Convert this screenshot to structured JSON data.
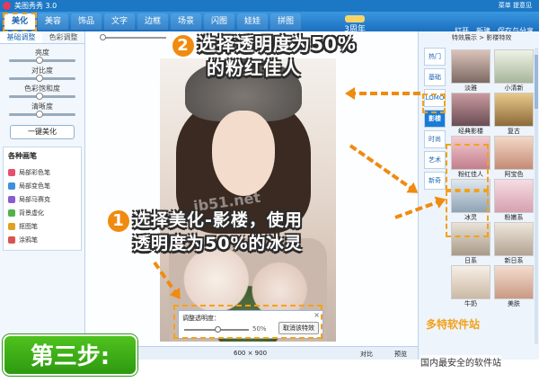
{
  "app": {
    "title": "美图秀秀 3.0"
  },
  "header": {
    "tabs": [
      "美化",
      "美容",
      "饰品",
      "文字",
      "边框",
      "场景",
      "闪图",
      "娃娃",
      "拼图"
    ],
    "active_tab": "美化",
    "anniversary": "3周年",
    "top_links": "菜单  提意见",
    "actions": {
      "open": "打开",
      "new": "新建",
      "save": "保存与分享"
    }
  },
  "left_panel": {
    "tabs": [
      "基础调整",
      "色彩调整"
    ],
    "sliders": [
      "亮度",
      "对比度",
      "色彩饱和度",
      "清晰度"
    ],
    "one_key_button": "一键美化",
    "brushes_title": "各种画笔",
    "brushes": [
      "局部彩色笔",
      "局部变色笔",
      "局部马赛克",
      "背景虚化",
      "抠图笔",
      "涂鸦笔"
    ]
  },
  "canvas": {
    "watermark": "jb51.net",
    "transparency": {
      "label": "调整透明度：",
      "value": "50%",
      "cancel": "取消该特效",
      "close": "×"
    },
    "image_size": "600 × 900",
    "compare": "对比",
    "preview": "预览"
  },
  "right_panel": {
    "header": "特效展示 > 影楼特效",
    "categories": [
      "热门",
      "基础",
      "LOMO",
      "影楼",
      "时尚",
      "艺术",
      "新奇"
    ],
    "active_category": "影楼",
    "effects": [
      "淡雅",
      "小清新",
      "经典影楼",
      "复古",
      "粉红佳人",
      "阿宝色",
      "冰灵",
      "粉嫩系",
      "日系",
      "新日系",
      "牛奶",
      "美肤"
    ]
  },
  "annotations": {
    "step2_num": "2",
    "step2_line1": "选择透明度为50%",
    "step2_line2": "的粉红佳人",
    "step1_num": "1",
    "step1_line1": "选择美化-影楼，使用",
    "step1_line2": "透明度为50%的冰灵",
    "step_badge": "第三步:",
    "site_logo": "多特软件站",
    "site_tag": "国内最安全的软件站"
  }
}
